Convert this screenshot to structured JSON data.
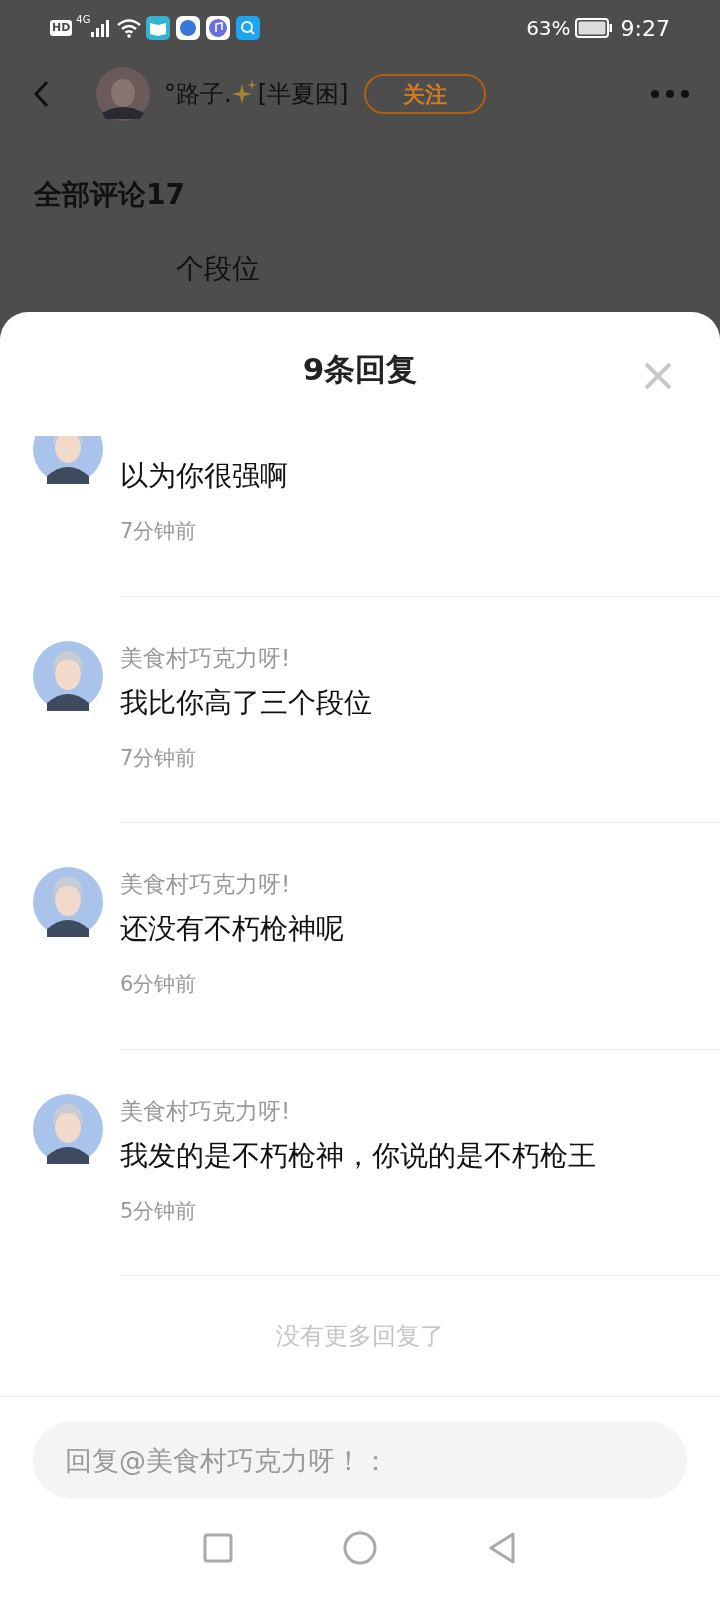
{
  "status_bar": {
    "hd": "HD",
    "network": "4G",
    "battery": "63%",
    "time": "9:27"
  },
  "header": {
    "username": "°路子.",
    "tag": "[半夏困]",
    "follow": "关注"
  },
  "comments_heading": "全部评论17",
  "background_text": "个段位",
  "sheet": {
    "title": "9条回复",
    "replies": [
      {
        "text": "以为你很强啊",
        "time": "7分钟前"
      },
      {
        "name": "美食村巧克力呀!",
        "text": "我比你高了三个段位",
        "time": "7分钟前"
      },
      {
        "name": "美食村巧克力呀!",
        "text": "还没有不朽枪神呢",
        "time": "6分钟前"
      },
      {
        "name": "美食村巧克力呀!",
        "text": "我发的是不朽枪神，你说的是不朽枪王",
        "time": "5分钟前"
      }
    ],
    "end_note": "没有更多回复了",
    "reply_input": {
      "placeholder": "回复@美食村巧克力呀！："
    }
  }
}
